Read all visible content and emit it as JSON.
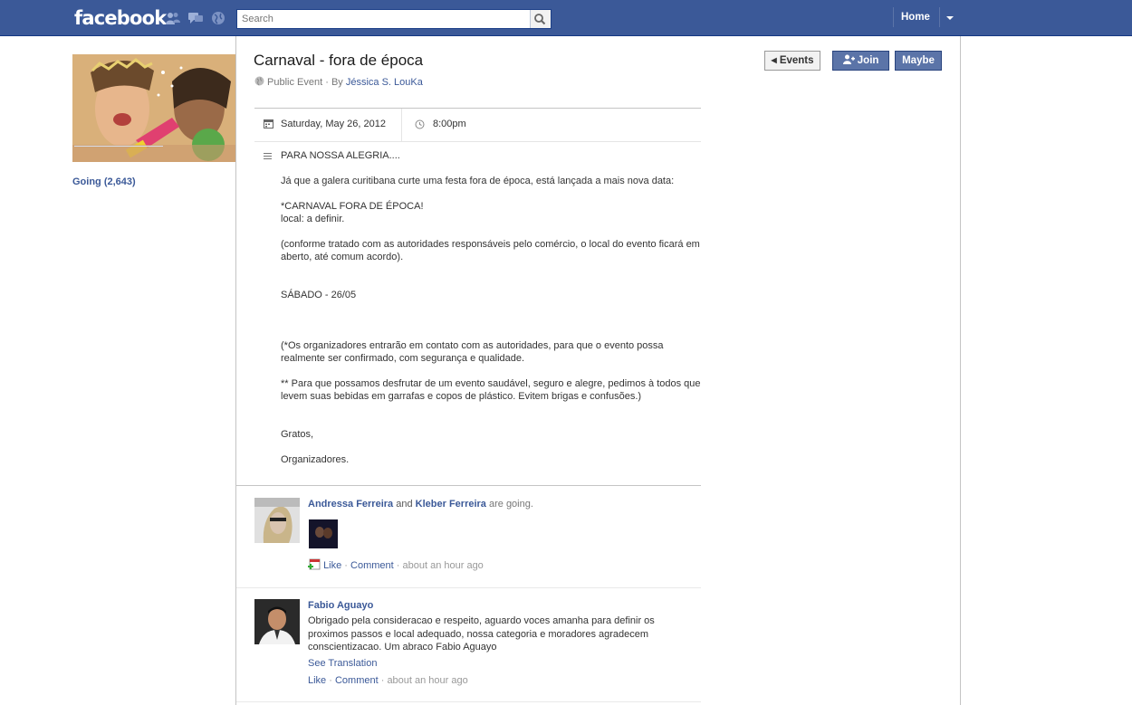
{
  "topbar": {
    "logo": "facebook",
    "search_placeholder": "Search",
    "home_label": "Home"
  },
  "sidebar": {
    "going_label": "Going (2,643)"
  },
  "event": {
    "title": "Carnaval - fora de época",
    "privacy": "Public Event",
    "by_prefix": "· By",
    "host": "Jéssica S. LouKa",
    "date": "Saturday, May 26, 2012",
    "time": "8:00pm",
    "description": [
      "PARA NOSSA ALEGRIA....",
      "",
      "Já que a galera curitibana curte uma festa fora de época, está lançada a mais nova data:",
      "",
      "*CARNAVAL FORA DE ÉPOCA!",
      "local: a definir.",
      "",
      "(conforme tratado com as autoridades responsáveis pelo comércio, o local do evento ficará em aberto, até comum acordo).",
      "",
      "",
      "SÁBADO - 26/05",
      "",
      "",
      "",
      "(*Os organizadores entrarão em contato com as autoridades, para que o evento possa realmente ser confirmado, com segurança e qualidade.",
      "",
      "** Para que possamos desfrutar de um evento saudável, seguro e alegre, pedimos à todos que levem suas bebidas em garrafas e copos de plástico. Evitem brigas e confusões.)",
      "",
      "",
      "Gratos,",
      "",
      "Organizadores."
    ]
  },
  "actions": {
    "events_label": "Events",
    "join_label": "Join",
    "maybe_label": "Maybe"
  },
  "posts": [
    {
      "author1": "Andressa Ferreira",
      "conj": "and",
      "author2": "Kleber Ferreira",
      "status": "are going.",
      "like": "Like",
      "comment": "Comment",
      "time": "about an hour ago"
    },
    {
      "author": "Fabio Aguayo",
      "text": "Obrigado pela consideracao e respeito, aguardo voces amanha para definir os proximos passos e local adequado, nossa categoria e moradores agradecem conscientizacao. Um abraco Fabio Aguayo",
      "translate": "See Translation",
      "like": "Like",
      "comment": "Comment",
      "time": "about an hour ago"
    }
  ],
  "colors": {
    "brand": "#3b5998",
    "button": "#5b74a8"
  }
}
